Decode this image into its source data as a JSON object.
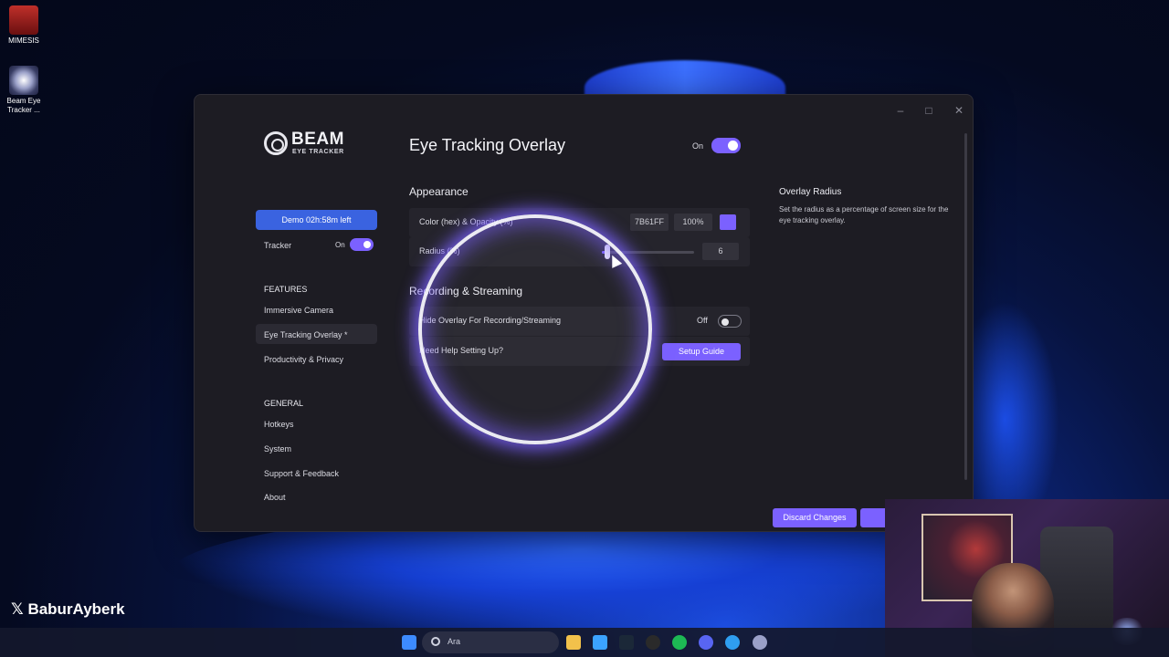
{
  "desktop": {
    "icons": [
      {
        "label": "MIMESIS"
      },
      {
        "label": "Beam Eye Tracker ..."
      }
    ],
    "social_handle": "BaburAyberk"
  },
  "app": {
    "logo": {
      "name": "BEAM",
      "sub": "EYE TRACKER"
    },
    "sidebar": {
      "demo_label": "Demo 02h:58m left",
      "tracker_label": "Tracker",
      "tracker_state": "On",
      "features_heading": "FEATURES",
      "features": [
        {
          "label": "Immersive Camera"
        },
        {
          "label": "Eye Tracking Overlay *"
        },
        {
          "label": "Productivity & Privacy"
        }
      ],
      "general_heading": "GENERAL",
      "general": [
        {
          "label": "Hotkeys"
        },
        {
          "label": "System"
        },
        {
          "label": "Support & Feedback"
        },
        {
          "label": "About"
        }
      ]
    },
    "main": {
      "title": "Eye Tracking Overlay",
      "enabled_label": "On",
      "appearance_heading": "Appearance",
      "color_row": {
        "label": "Color (hex) & Opacity (%)",
        "hex": "7B61FF",
        "opacity": "100%",
        "swatch_color": "#7B61FF"
      },
      "radius_row": {
        "label": "Radius (%)",
        "value": "6",
        "slider_fraction": 0.06
      },
      "recording_heading": "Recording & Streaming",
      "hide_row": {
        "label": "Hide Overlay For Recording/Streaming",
        "state": "Off"
      },
      "help_row": {
        "label": "Need Help Setting Up?",
        "button": "Setup Guide"
      }
    },
    "help_panel": {
      "title": "Overlay Radius",
      "body": "Set the radius as a percentage of screen size for the eye tracking overlay."
    },
    "footer": {
      "discard_label": "Discard Changes"
    }
  },
  "taskbar": {
    "search_placeholder": "Ara"
  },
  "colors": {
    "accent": "#7B61FF",
    "demo": "#3A63E0",
    "window_bg": "#1D1C23"
  }
}
